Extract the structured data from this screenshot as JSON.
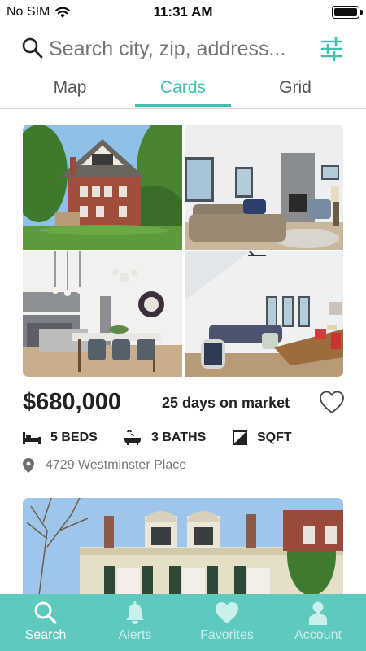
{
  "status_bar": {
    "carrier": "No SIM",
    "time": "11:31 AM"
  },
  "search": {
    "placeholder": "Search city, zip, address..."
  },
  "tabs": [
    {
      "label": "Map"
    },
    {
      "label": "Cards"
    },
    {
      "label": "Grid"
    }
  ],
  "selected_tab": "Cards",
  "listing": {
    "price": "$680,000",
    "days_on_market": "25 days on market",
    "beds": "5 BEDS",
    "baths": "3 BATHS",
    "sqft": "SQFT",
    "address": "4729 Westminster Place",
    "photos": [
      "exterior",
      "living-room",
      "kitchen",
      "loft"
    ]
  },
  "bottom_nav": [
    {
      "label": "Search",
      "icon": "search-icon"
    },
    {
      "label": "Alerts",
      "icon": "bell-icon"
    },
    {
      "label": "Favorites",
      "icon": "heart-icon"
    },
    {
      "label": "Account",
      "icon": "person-icon"
    }
  ],
  "colors": {
    "accent": "#3fbfb0",
    "tab_bar": "#5ec9bd"
  }
}
